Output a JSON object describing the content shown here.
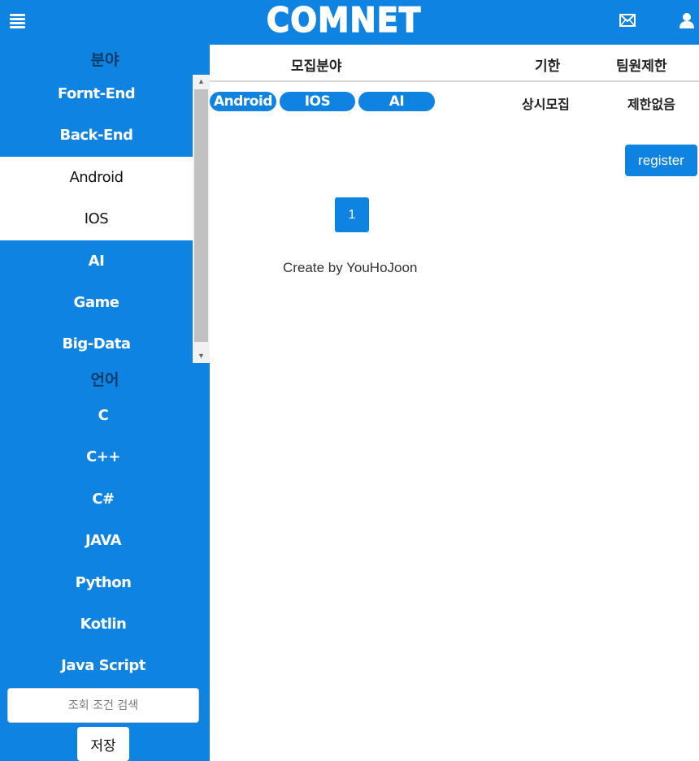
{
  "header": {
    "logo": "COMNET",
    "icons": {
      "menu": "hamburger-menu-icon",
      "mail": "mail-icon",
      "user": "user-icon"
    },
    "accent_color": "#0f83e2"
  },
  "sidebar": {
    "field_heading": "분야",
    "fields": [
      {
        "label": "Fornt-End",
        "selected": false
      },
      {
        "label": "Back-End",
        "selected": false
      },
      {
        "label": "Android",
        "selected": true
      },
      {
        "label": "IOS",
        "selected": true
      },
      {
        "label": "AI",
        "selected": false
      },
      {
        "label": "Game",
        "selected": false
      },
      {
        "label": "Big-Data",
        "selected": false
      }
    ],
    "language_heading": "언어",
    "languages": [
      "C",
      "C++",
      "C#",
      "JAVA",
      "Python",
      "Kotlin",
      "Java Script"
    ],
    "search_placeholder": "조회 조건 검색",
    "save_label": "저장"
  },
  "table": {
    "headers": {
      "field": "모집분야",
      "deadline": "기한",
      "limit": "팀원제한"
    },
    "rows": [
      {
        "tags": [
          "Android",
          "IOS",
          "AI"
        ],
        "deadline": "상시모집",
        "limit": "제한없음"
      }
    ]
  },
  "register_label": "register",
  "pagination": {
    "current": "1"
  },
  "footer": "Create by YouHoJoon"
}
